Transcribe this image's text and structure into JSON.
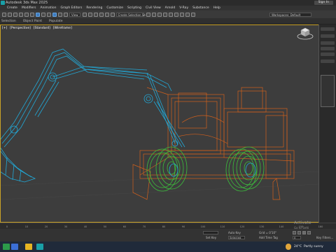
{
  "window": {
    "title": "Autodesk 3ds Max 2025",
    "sign_in": "Sign In"
  },
  "menu": {
    "items": [
      "Create",
      "Modifiers",
      "Animation",
      "Graph Editors",
      "Rendering",
      "Customize",
      "Scripting",
      "Civil View",
      "Arnold",
      "V-Ray",
      "Substance",
      "Help"
    ]
  },
  "toolbar": {
    "view_dropdown": "View",
    "selection_set": "Create Selection Se",
    "workspace": "Workspaces: Default"
  },
  "ribbon": {
    "items": [
      "Selection",
      "Object Paint",
      "Populate"
    ]
  },
  "viewport": {
    "labels": [
      "[+]",
      "[Perspective]",
      "[Standard]",
      "[Wireframe]"
    ],
    "viewcube_label": "TOP"
  },
  "timeline": {
    "ticks": [
      "0",
      "10",
      "20",
      "30",
      "40",
      "50",
      "60",
      "70",
      "80",
      "90",
      "100",
      "110",
      "120",
      "130",
      "140",
      "150",
      "160"
    ]
  },
  "status": {
    "grid": "Grid = 0'10\"",
    "add_time_tag": "Add Time Tag",
    "auto_key": "Auto Key",
    "selected": "Selected",
    "set_key": "Set Key",
    "key_filters": "Key Filters...",
    "frame": "0"
  },
  "watermark": {
    "line1": "Activate",
    "line2": "Go to Setti"
  },
  "taskbar": {
    "weather_temp": "24°C",
    "weather_desc": "Partly sunny"
  },
  "colors": {
    "viewport_bg": "#3d3d3d",
    "excavator_arm": "#22a8d6",
    "excavator_body": "#d2601c",
    "wheel": "#3cc03c",
    "active_border": "#c9a227"
  }
}
